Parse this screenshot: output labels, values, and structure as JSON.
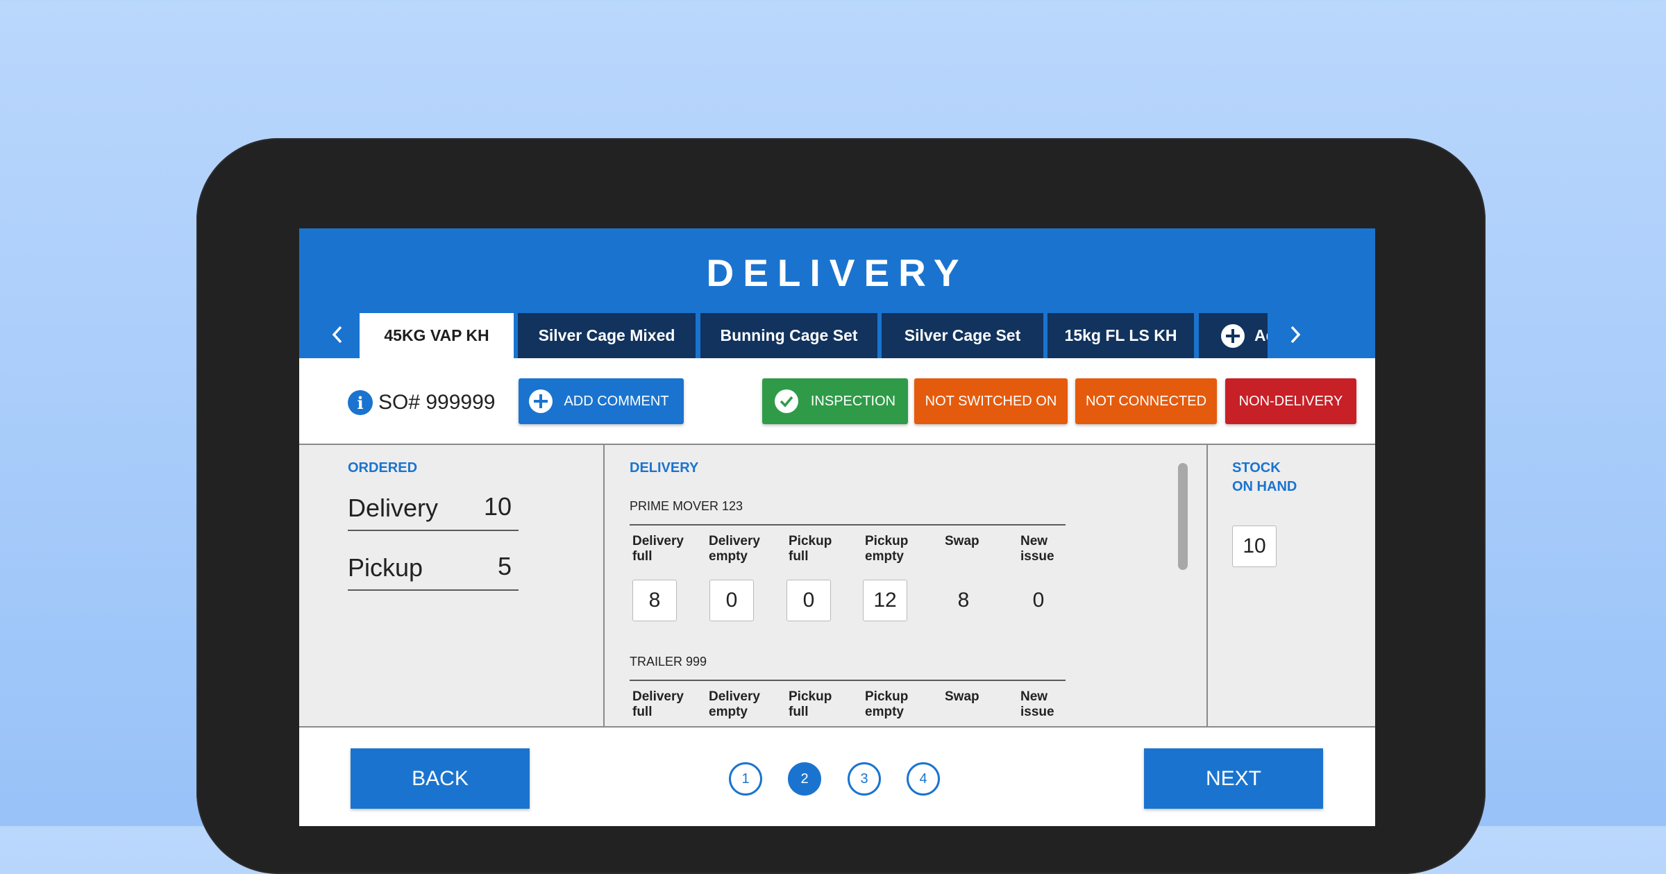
{
  "header": {
    "title": "DELIVERY"
  },
  "tabs": [
    {
      "label": "45KG VAP KH",
      "active": true
    },
    {
      "label": "Silver Cage Mixed",
      "active": false
    },
    {
      "label": "Bunning Cage Set",
      "active": false
    },
    {
      "label": "Silver Cage Set",
      "active": false
    },
    {
      "label": "15kg FL LS KH",
      "active": false
    }
  ],
  "add_product_tab": {
    "label": "Add Product",
    "icon": "plus-circle-icon"
  },
  "order": {
    "so_number": "SO# 999999"
  },
  "actions": {
    "add_comment": "ADD COMMENT",
    "inspection": "INSPECTION",
    "not_switched_on": "NOT SWITCHED ON",
    "not_connected": "NOT CONNECTED",
    "non_delivery": "NON-DELIVERY"
  },
  "colors": {
    "primary": "#1a74cf",
    "tab_dark": "#11335d",
    "success": "#2f9b48",
    "warning": "#e55b0d",
    "danger": "#c82027"
  },
  "ordered": {
    "heading": "ORDERED",
    "rows": [
      {
        "label": "Delivery",
        "value": "10"
      },
      {
        "label": "Pickup",
        "value": "5"
      }
    ]
  },
  "delivery": {
    "heading": "DELIVERY",
    "columns": [
      "Delivery\nfull",
      "Delivery\nempty",
      "Pickup\nfull",
      "Pickup\nempty",
      "Swap",
      "New\nissue"
    ],
    "vehicles": [
      {
        "name": "PRIME MOVER 123",
        "values": [
          "8",
          "0",
          "0",
          "12",
          "8",
          "0"
        ]
      },
      {
        "name": "TRAILER 999"
      }
    ]
  },
  "stock": {
    "heading": "STOCK\nON HAND",
    "value": "10"
  },
  "footer": {
    "back": "BACK",
    "next": "NEXT",
    "pages": [
      "1",
      "2",
      "3",
      "4"
    ],
    "current_page": "2"
  }
}
